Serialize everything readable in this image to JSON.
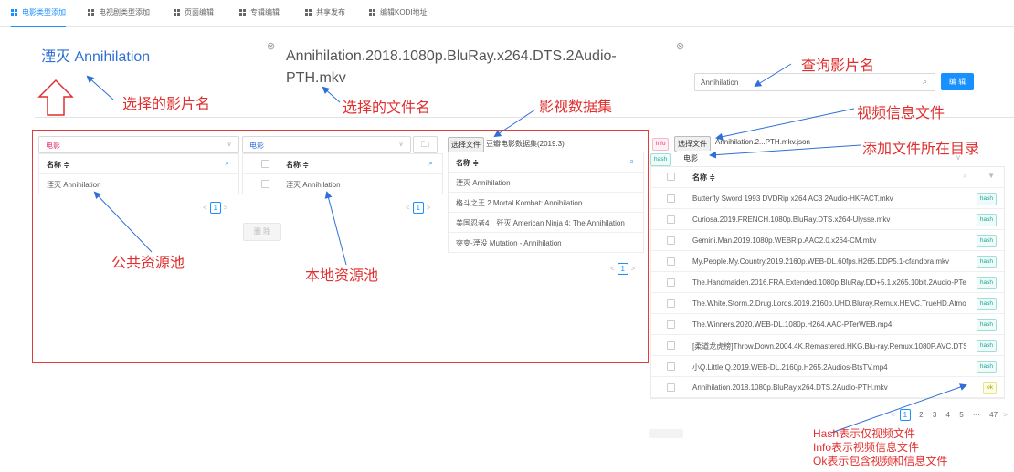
{
  "tabs": [
    {
      "label": "电影类型添加",
      "active": true
    },
    {
      "label": "电视剧类型添加",
      "active": false
    },
    {
      "label": "页面编辑",
      "active": false
    },
    {
      "label": "专辑编辑",
      "active": false
    },
    {
      "label": "共享发布",
      "active": false
    },
    {
      "label": "编辑KODI地址",
      "active": false
    }
  ],
  "selected_movie": "湮灭 Annihilation",
  "selected_file": "Annihilation.2018.1080p.BluRay.x264.DTS.2Audio-PTH.mkv",
  "close_glyph": "⊗",
  "search": {
    "value": "Annihilation",
    "edit_label": "编 辑"
  },
  "public_pool": {
    "select_value": "电影",
    "column": "名称 ≑",
    "rows": [
      "湮灭 Annihilation"
    ],
    "page": "1",
    "delete_label": "删 除"
  },
  "local_pool": {
    "select_value": "电影",
    "column": "名称 ≑",
    "rows": [
      "湮灭 Annihilation"
    ],
    "page": "1"
  },
  "dataset": {
    "choose_label": "选择文件",
    "dataset_name": "豆瓣电影数据集(2019.3)",
    "column": "名称 ≑",
    "rows": [
      "湮灭 Annihilation",
      "格斗之王 2 Mortal Kombat: Annihilation",
      "美国忍者4：歼灭 American Ninja 4: The Annihilation",
      "突变-湮没 Mutation - Annihilation"
    ],
    "page": "1"
  },
  "file_panel": {
    "info_tag": "info",
    "choose_label": "选择文件",
    "info_file": "Annihilation.2...PTH.mkv.json",
    "hash_tag": "hash",
    "dir_value": "电影",
    "column": "名称 ≑",
    "rows": [
      {
        "name": "Butterfly Sword 1993 DVDRip x264 AC3 2Audio-HKFACT.mkv",
        "tag": "hash"
      },
      {
        "name": "Curiosa.2019.FRENCH.1080p.BluRay.DTS.x264-Ulysse.mkv",
        "tag": "hash"
      },
      {
        "name": "Gemini.Man.2019.1080p.WEBRip.AAC2.0.x264-CM.mkv",
        "tag": "hash"
      },
      {
        "name": "My.People.My.Country.2019.2160p.WEB-DL.60fps.H265.DDP5.1-cfandora.mkv",
        "tag": "hash"
      },
      {
        "name": "The.Handmaiden.2016.FRA.Extended.1080p.BluRay.DD+5.1.x265.10bit.2Audio-PTe...",
        "tag": "hash"
      },
      {
        "name": "The.White.Storm.2.Drug.Lords.2019.2160p.UHD.Bluray.Remux.HEVC.TrueHD.Atmos...",
        "tag": "hash"
      },
      {
        "name": "The.Winners.2020.WEB-DL.1080p.H264.AAC-PTerWEB.mp4",
        "tag": "hash"
      },
      {
        "name": "[柔道龙虎榜]Throw.Down.2004.4K.Remastered.HKG.Blu-ray.Remux.1080P.AVC.DTS-...",
        "tag": "hash"
      },
      {
        "name": "小Q.Little.Q.2019.WEB-DL.2160p.H265.2Audios-BtsTV.mp4",
        "tag": "hash"
      },
      {
        "name": "Annihilation.2018.1080p.BluRay.x264.DTS.2Audio-PTH.mkv",
        "tag": "ok"
      }
    ],
    "pager": {
      "prev": "<",
      "current": "1",
      "pages": [
        "2",
        "3",
        "4",
        "5",
        "···",
        "47"
      ],
      "next": ">"
    }
  },
  "annotations": {
    "movie_name": "选择的影片名",
    "file_name": "选择的文件名",
    "dataset": "影视数据集",
    "query": "查询影片名",
    "info_file": "视频信息文件",
    "add_dir": "添加文件所在目录",
    "public_pool": "公共资源池",
    "local_pool": "本地资源池",
    "legend": [
      "Hash表示仅视频文件",
      "Info表示视频信息文件",
      "Ok表示包含视频和信息文件"
    ]
  },
  "colors": {
    "accent": "#1890ff",
    "annotation": "#e12f2f",
    "title": "#2f6fd6"
  }
}
